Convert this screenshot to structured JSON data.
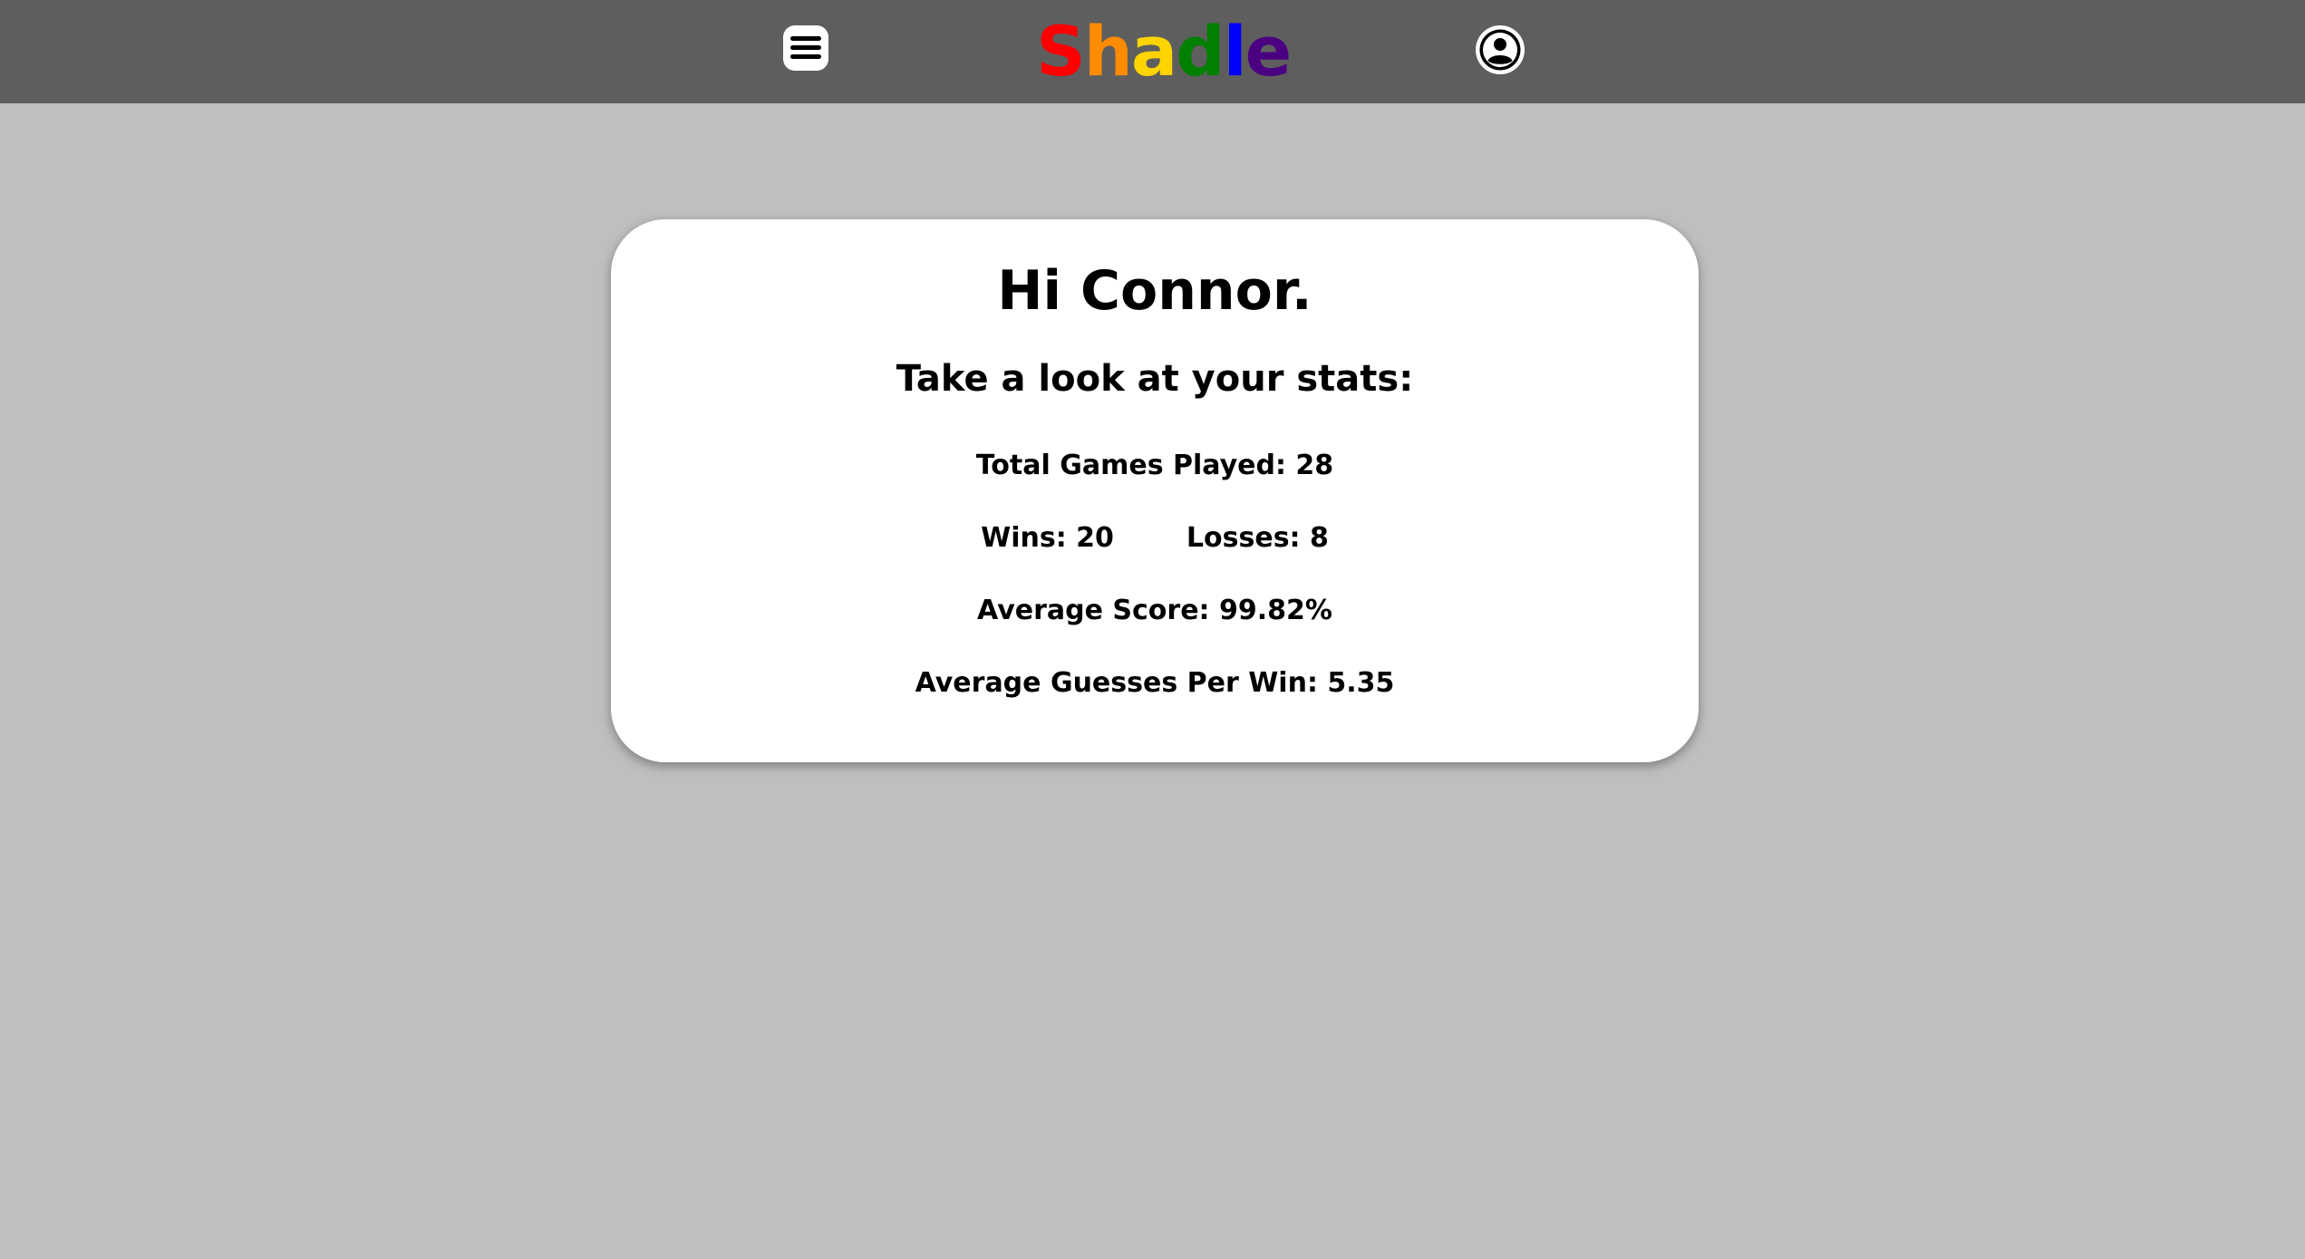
{
  "header": {
    "logo_letters": [
      {
        "char": "S",
        "color": "#ff0000"
      },
      {
        "char": "h",
        "color": "#ff8c00"
      },
      {
        "char": "a",
        "color": "#ffd400"
      },
      {
        "char": "d",
        "color": "#008000"
      },
      {
        "char": "l",
        "color": "#0000ff"
      },
      {
        "char": "e",
        "color": "#4b0082"
      }
    ],
    "menu_icon": "hamburger-menu-icon",
    "account_icon": "user-account-icon",
    "bar_color": "#5e5e5e"
  },
  "stats_card": {
    "greeting": "Hi Connor.",
    "subtitle": "Take a look at your stats:",
    "total_games": "Total Games Played: 28",
    "wins": "Wins: 20",
    "losses": "Losses: 8",
    "average_score": "Average Score: 99.82%",
    "average_guesses": "Average Guesses Per Win: 5.35"
  },
  "page": {
    "background_color": "#bfbfbf"
  }
}
